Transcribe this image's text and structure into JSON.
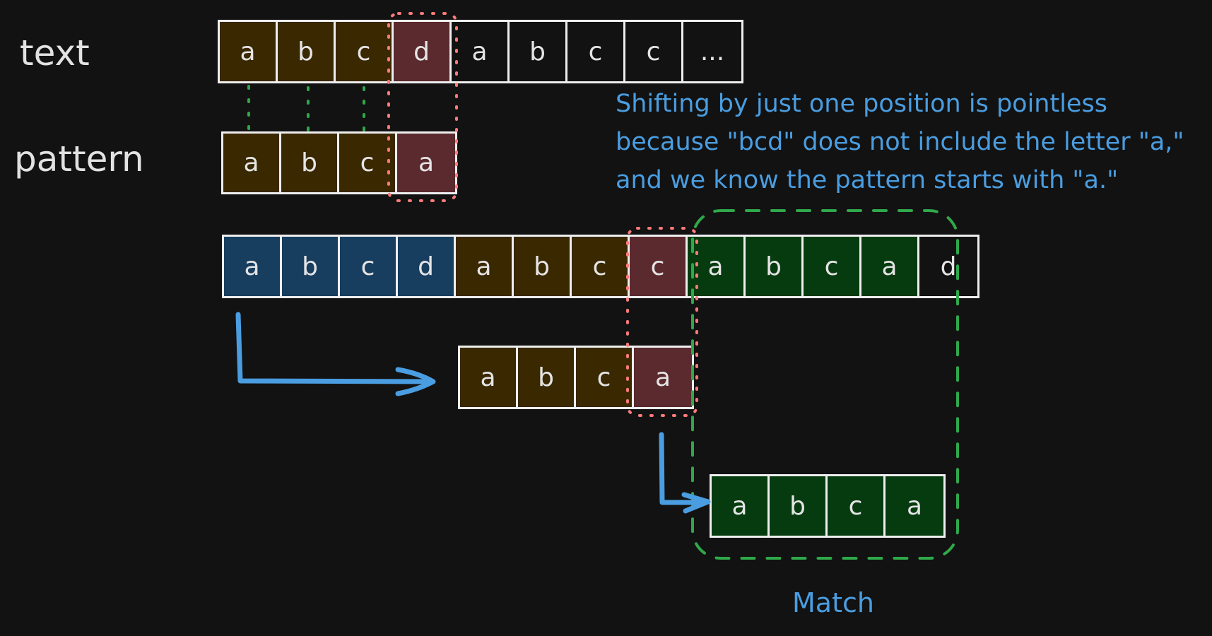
{
  "labels": {
    "text": "text",
    "pattern": "pattern",
    "match": "Match"
  },
  "note": {
    "lines": [
      "Shifting by just one position is pointless",
      "because \"bcd\" does not include the letter \"a,\"",
      "and we know the pattern starts with \"a.\""
    ]
  },
  "colors": {
    "background": "#121212",
    "compared": "#3a2800",
    "mismatch": "#5a2a2e",
    "skipped": "#173d5f",
    "matched": "#063b0f",
    "annotation_text": "#4a9de0",
    "mismatch_outline": "#ff7b7b",
    "match_outline": "#2fa84a",
    "arrow": "#4a9de0"
  },
  "step1": {
    "text_cells": [
      {
        "ch": "a",
        "state": "compared"
      },
      {
        "ch": "b",
        "state": "compared"
      },
      {
        "ch": "c",
        "state": "compared"
      },
      {
        "ch": "d",
        "state": "mismatch"
      },
      {
        "ch": "a",
        "state": "none"
      },
      {
        "ch": "b",
        "state": "none"
      },
      {
        "ch": "c",
        "state": "none"
      },
      {
        "ch": "c",
        "state": "none"
      },
      {
        "ch": "...",
        "state": "none"
      }
    ],
    "pattern_cells": [
      {
        "ch": "a",
        "state": "compared"
      },
      {
        "ch": "b",
        "state": "compared"
      },
      {
        "ch": "c",
        "state": "compared"
      },
      {
        "ch": "a",
        "state": "mismatch"
      }
    ]
  },
  "step2": {
    "text_cells": [
      {
        "ch": "a",
        "state": "skipped"
      },
      {
        "ch": "b",
        "state": "skipped"
      },
      {
        "ch": "c",
        "state": "skipped"
      },
      {
        "ch": "d",
        "state": "skipped"
      },
      {
        "ch": "a",
        "state": "compared"
      },
      {
        "ch": "b",
        "state": "compared"
      },
      {
        "ch": "c",
        "state": "compared"
      },
      {
        "ch": "c",
        "state": "mismatch"
      },
      {
        "ch": "a",
        "state": "matched"
      },
      {
        "ch": "b",
        "state": "matched"
      },
      {
        "ch": "c",
        "state": "matched"
      },
      {
        "ch": "a",
        "state": "matched"
      },
      {
        "ch": "d",
        "state": "none"
      }
    ],
    "pattern_shift1_cells": [
      {
        "ch": "a",
        "state": "compared"
      },
      {
        "ch": "b",
        "state": "compared"
      },
      {
        "ch": "c",
        "state": "compared"
      },
      {
        "ch": "a",
        "state": "mismatch"
      }
    ],
    "pattern_shift2_cells": [
      {
        "ch": "a",
        "state": "matched"
      },
      {
        "ch": "b",
        "state": "matched"
      },
      {
        "ch": "c",
        "state": "matched"
      },
      {
        "ch": "a",
        "state": "matched"
      }
    ]
  }
}
